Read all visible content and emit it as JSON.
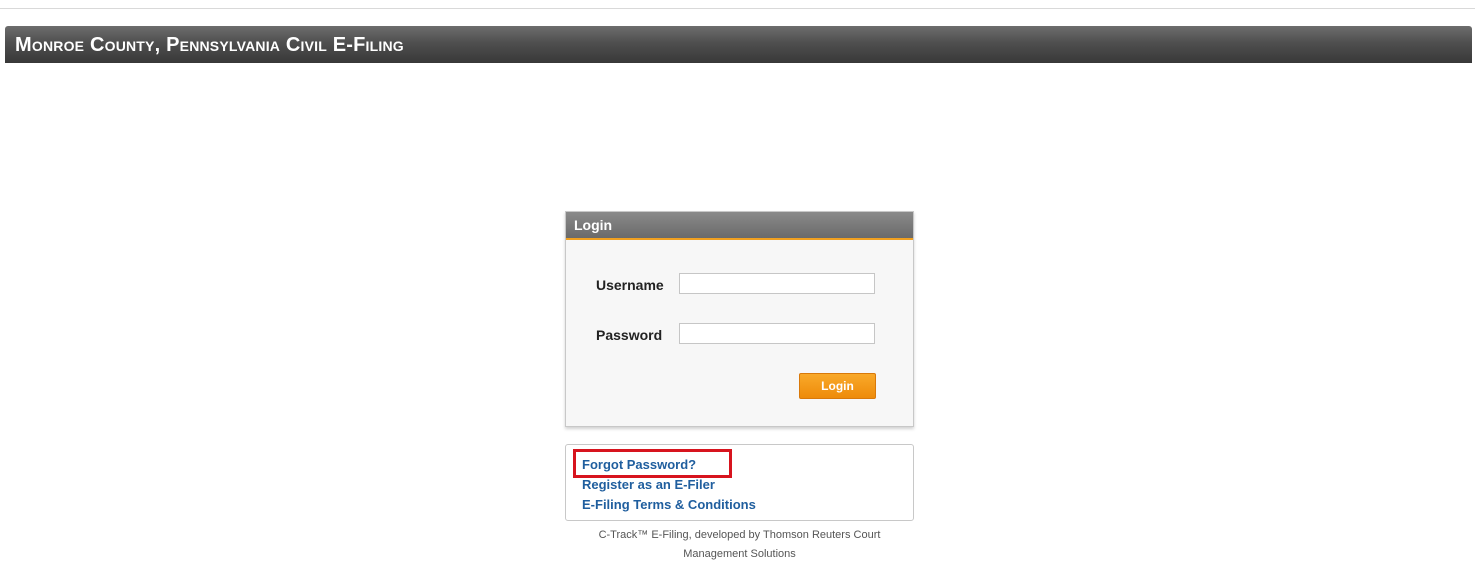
{
  "banner": {
    "title": "Monroe County, Pennsylvania Civil E-Filing"
  },
  "login": {
    "header": "Login",
    "username_label": "Username",
    "username_value": "",
    "password_label": "Password",
    "password_value": "",
    "button_label": "Login"
  },
  "links": {
    "forgot_password": "Forgot Password?",
    "register": "Register as an E-Filer",
    "terms": "E-Filing Terms & Conditions"
  },
  "footer": {
    "line1": "C-Track™ E-Filing, developed by Thomson Reuters Court",
    "line2": "Management Solutions"
  },
  "colors": {
    "banner": "#4f4f4f",
    "accent": "#f0a020",
    "button": "#ee8b0a",
    "link": "#1f5e9e",
    "highlight": "#d7141e"
  }
}
